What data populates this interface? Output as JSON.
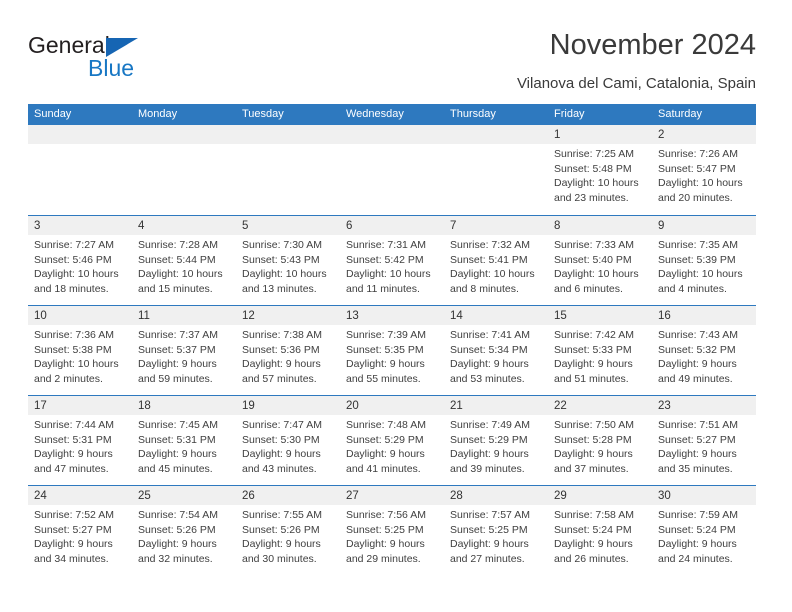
{
  "brand": {
    "word_one": "General",
    "word_two": "Blue",
    "triangle_color": "#1665b3",
    "blue_color": "#1877c4"
  },
  "header": {
    "title": "November 2024",
    "subtitle": "Vilanova del Cami, Catalonia, Spain"
  },
  "theme": {
    "header_blue": "#2e79bf",
    "day_strip_gray": "#f0f0f0",
    "text_color": "#404040"
  },
  "weekdays": [
    "Sunday",
    "Monday",
    "Tuesday",
    "Wednesday",
    "Thursday",
    "Friday",
    "Saturday"
  ],
  "weeks": [
    [
      {
        "day": "",
        "lines": []
      },
      {
        "day": "",
        "lines": []
      },
      {
        "day": "",
        "lines": []
      },
      {
        "day": "",
        "lines": []
      },
      {
        "day": "",
        "lines": []
      },
      {
        "day": "1",
        "lines": [
          "Sunrise: 7:25 AM",
          "Sunset: 5:48 PM",
          "Daylight: 10 hours",
          "and 23 minutes."
        ]
      },
      {
        "day": "2",
        "lines": [
          "Sunrise: 7:26 AM",
          "Sunset: 5:47 PM",
          "Daylight: 10 hours",
          "and 20 minutes."
        ]
      }
    ],
    [
      {
        "day": "3",
        "lines": [
          "Sunrise: 7:27 AM",
          "Sunset: 5:46 PM",
          "Daylight: 10 hours",
          "and 18 minutes."
        ]
      },
      {
        "day": "4",
        "lines": [
          "Sunrise: 7:28 AM",
          "Sunset: 5:44 PM",
          "Daylight: 10 hours",
          "and 15 minutes."
        ]
      },
      {
        "day": "5",
        "lines": [
          "Sunrise: 7:30 AM",
          "Sunset: 5:43 PM",
          "Daylight: 10 hours",
          "and 13 minutes."
        ]
      },
      {
        "day": "6",
        "lines": [
          "Sunrise: 7:31 AM",
          "Sunset: 5:42 PM",
          "Daylight: 10 hours",
          "and 11 minutes."
        ]
      },
      {
        "day": "7",
        "lines": [
          "Sunrise: 7:32 AM",
          "Sunset: 5:41 PM",
          "Daylight: 10 hours",
          "and 8 minutes."
        ]
      },
      {
        "day": "8",
        "lines": [
          "Sunrise: 7:33 AM",
          "Sunset: 5:40 PM",
          "Daylight: 10 hours",
          "and 6 minutes."
        ]
      },
      {
        "day": "9",
        "lines": [
          "Sunrise: 7:35 AM",
          "Sunset: 5:39 PM",
          "Daylight: 10 hours",
          "and 4 minutes."
        ]
      }
    ],
    [
      {
        "day": "10",
        "lines": [
          "Sunrise: 7:36 AM",
          "Sunset: 5:38 PM",
          "Daylight: 10 hours",
          "and 2 minutes."
        ]
      },
      {
        "day": "11",
        "lines": [
          "Sunrise: 7:37 AM",
          "Sunset: 5:37 PM",
          "Daylight: 9 hours",
          "and 59 minutes."
        ]
      },
      {
        "day": "12",
        "lines": [
          "Sunrise: 7:38 AM",
          "Sunset: 5:36 PM",
          "Daylight: 9 hours",
          "and 57 minutes."
        ]
      },
      {
        "day": "13",
        "lines": [
          "Sunrise: 7:39 AM",
          "Sunset: 5:35 PM",
          "Daylight: 9 hours",
          "and 55 minutes."
        ]
      },
      {
        "day": "14",
        "lines": [
          "Sunrise: 7:41 AM",
          "Sunset: 5:34 PM",
          "Daylight: 9 hours",
          "and 53 minutes."
        ]
      },
      {
        "day": "15",
        "lines": [
          "Sunrise: 7:42 AM",
          "Sunset: 5:33 PM",
          "Daylight: 9 hours",
          "and 51 minutes."
        ]
      },
      {
        "day": "16",
        "lines": [
          "Sunrise: 7:43 AM",
          "Sunset: 5:32 PM",
          "Daylight: 9 hours",
          "and 49 minutes."
        ]
      }
    ],
    [
      {
        "day": "17",
        "lines": [
          "Sunrise: 7:44 AM",
          "Sunset: 5:31 PM",
          "Daylight: 9 hours",
          "and 47 minutes."
        ]
      },
      {
        "day": "18",
        "lines": [
          "Sunrise: 7:45 AM",
          "Sunset: 5:31 PM",
          "Daylight: 9 hours",
          "and 45 minutes."
        ]
      },
      {
        "day": "19",
        "lines": [
          "Sunrise: 7:47 AM",
          "Sunset: 5:30 PM",
          "Daylight: 9 hours",
          "and 43 minutes."
        ]
      },
      {
        "day": "20",
        "lines": [
          "Sunrise: 7:48 AM",
          "Sunset: 5:29 PM",
          "Daylight: 9 hours",
          "and 41 minutes."
        ]
      },
      {
        "day": "21",
        "lines": [
          "Sunrise: 7:49 AM",
          "Sunset: 5:29 PM",
          "Daylight: 9 hours",
          "and 39 minutes."
        ]
      },
      {
        "day": "22",
        "lines": [
          "Sunrise: 7:50 AM",
          "Sunset: 5:28 PM",
          "Daylight: 9 hours",
          "and 37 minutes."
        ]
      },
      {
        "day": "23",
        "lines": [
          "Sunrise: 7:51 AM",
          "Sunset: 5:27 PM",
          "Daylight: 9 hours",
          "and 35 minutes."
        ]
      }
    ],
    [
      {
        "day": "24",
        "lines": [
          "Sunrise: 7:52 AM",
          "Sunset: 5:27 PM",
          "Daylight: 9 hours",
          "and 34 minutes."
        ]
      },
      {
        "day": "25",
        "lines": [
          "Sunrise: 7:54 AM",
          "Sunset: 5:26 PM",
          "Daylight: 9 hours",
          "and 32 minutes."
        ]
      },
      {
        "day": "26",
        "lines": [
          "Sunrise: 7:55 AM",
          "Sunset: 5:26 PM",
          "Daylight: 9 hours",
          "and 30 minutes."
        ]
      },
      {
        "day": "27",
        "lines": [
          "Sunrise: 7:56 AM",
          "Sunset: 5:25 PM",
          "Daylight: 9 hours",
          "and 29 minutes."
        ]
      },
      {
        "day": "28",
        "lines": [
          "Sunrise: 7:57 AM",
          "Sunset: 5:25 PM",
          "Daylight: 9 hours",
          "and 27 minutes."
        ]
      },
      {
        "day": "29",
        "lines": [
          "Sunrise: 7:58 AM",
          "Sunset: 5:24 PM",
          "Daylight: 9 hours",
          "and 26 minutes."
        ]
      },
      {
        "day": "30",
        "lines": [
          "Sunrise: 7:59 AM",
          "Sunset: 5:24 PM",
          "Daylight: 9 hours",
          "and 24 minutes."
        ]
      }
    ]
  ]
}
